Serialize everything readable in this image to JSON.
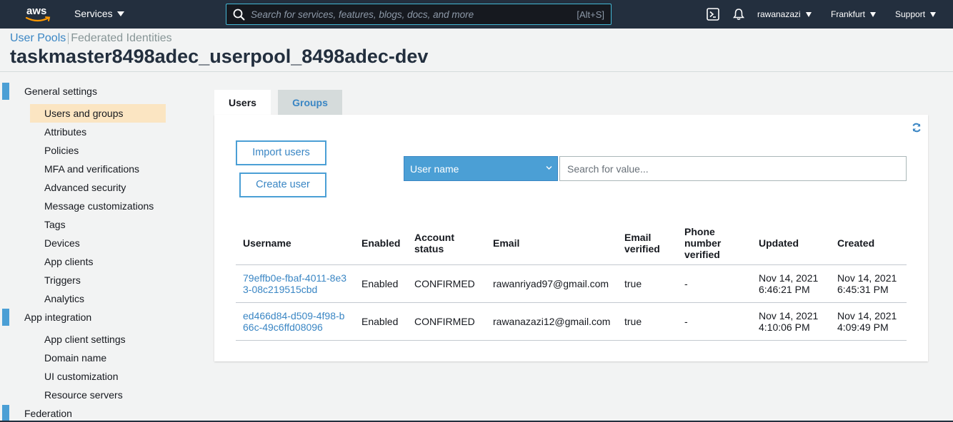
{
  "nav": {
    "logo_text": "aws",
    "services_label": "Services",
    "search_placeholder": "Search for services, features, blogs, docs, and more",
    "search_shortcut": "[Alt+S]",
    "user": "rawanazazi",
    "region": "Frankfurt",
    "support": "Support"
  },
  "breadcrumb": {
    "user_pools": "User Pools",
    "federated": "Federated Identities"
  },
  "page_title": "taskmaster8498adec_userpool_8498adec-dev",
  "sidebar": {
    "general_settings": "General settings",
    "general_items": [
      "Users and groups",
      "Attributes",
      "Policies",
      "MFA and verifications",
      "Advanced security",
      "Message customizations",
      "Tags",
      "Devices",
      "App clients",
      "Triggers",
      "Analytics"
    ],
    "app_integration": "App integration",
    "app_items": [
      "App client settings",
      "Domain name",
      "UI customization",
      "Resource servers"
    ],
    "federation": "Federation"
  },
  "tabs": {
    "users": "Users",
    "groups": "Groups"
  },
  "actions": {
    "import_users": "Import users",
    "create_user": "Create user",
    "filter_attribute": "User name",
    "search_placeholder": "Search for value..."
  },
  "table": {
    "headers": [
      "Username",
      "Enabled",
      "Account status",
      "Email",
      "Email verified",
      "Phone number verified",
      "Updated",
      "Created"
    ],
    "rows": [
      {
        "username": "79effb0e-fbaf-4011-8e33-08c219515cbd",
        "enabled": "Enabled",
        "status": "CONFIRMED",
        "email": "rawanriyad97@gmail.com",
        "email_verified": "true",
        "phone_verified": "-",
        "updated_date": "Nov 14, 2021",
        "updated_time": "6:46:21 PM",
        "created_date": "Nov 14, 2021",
        "created_time": "6:45:31 PM"
      },
      {
        "username": "ed466d84-d509-4f98-b66c-49c6ffd08096",
        "enabled": "Enabled",
        "status": "CONFIRMED",
        "email": "rawanazazi12@gmail.com",
        "email_verified": "true",
        "phone_verified": "-",
        "updated_date": "Nov 14, 2021",
        "updated_time": "4:10:06 PM",
        "created_date": "Nov 14, 2021",
        "created_time": "4:09:49 PM"
      }
    ]
  },
  "colors": {
    "nav_bg": "#232f3e",
    "accent": "#4b9fd5",
    "link": "#3a86c4",
    "active_item": "#fbe5c2",
    "aws_orange": "#ff9900"
  }
}
